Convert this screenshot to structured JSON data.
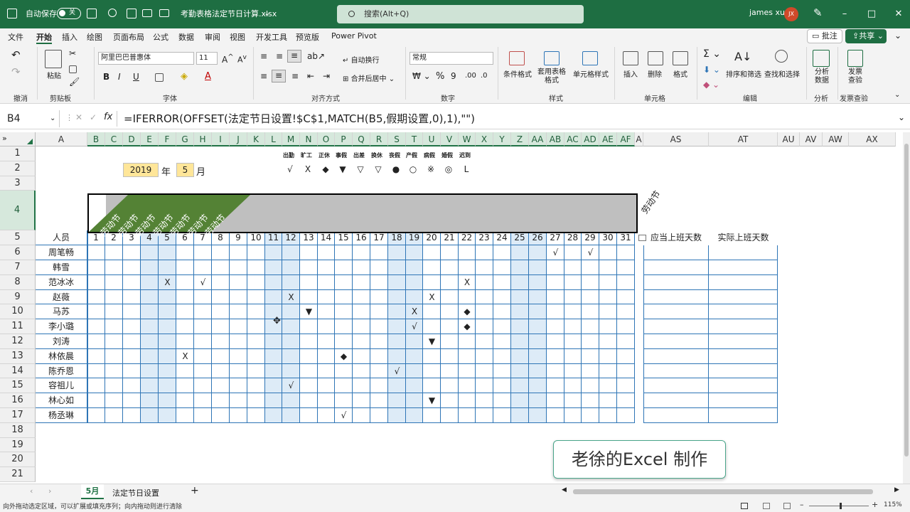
{
  "titlebar": {
    "autosave": "自动保存",
    "autosave_state": "关",
    "filename": "考勤表格法定节日计算.xlsx",
    "search_placeholder": "搜索(Alt+Q)",
    "user": "james xu",
    "initials": "JX"
  },
  "menu": {
    "items": [
      "文件",
      "开始",
      "插入",
      "绘图",
      "页面布局",
      "公式",
      "数据",
      "审阅",
      "视图",
      "开发工具",
      "预览版",
      "Power Pivot"
    ],
    "active": "开始",
    "comment": "批注",
    "share": "共享"
  },
  "ribbon": {
    "undo_group": "撤消",
    "clipboard": {
      "label": "剪贴板",
      "paste": "粘贴"
    },
    "font": {
      "label": "字体",
      "name": "阿里巴巴普惠体",
      "size": "11",
      "bold": "B",
      "italic": "I",
      "underline": "U"
    },
    "align": {
      "label": "对齐方式",
      "wrap": "自动换行",
      "merge": "合并后居中"
    },
    "number": {
      "label": "数字",
      "format": "常规"
    },
    "styles": {
      "label": "样式",
      "cond": "条件格式",
      "table": "套用表格格式",
      "cell": "单元格样式"
    },
    "cells": {
      "label": "单元格",
      "insert": "插入",
      "delete": "删除",
      "format": "格式"
    },
    "edit": {
      "label": "编辑",
      "sort": "排序和筛选",
      "find": "查找和选择"
    },
    "analysis": {
      "label": "分析",
      "btn": "分析数据"
    },
    "invoice": {
      "label": "发票查验",
      "btn": "发票查验"
    }
  },
  "formula_bar": {
    "cell": "B4",
    "formula": "=IFERROR(OFFSET(法定节日设置!$C$1,MATCH(B5,假期设置,0),1),\"\")",
    "fx": "fx"
  },
  "columns": [
    "A",
    "B",
    "C",
    "D",
    "E",
    "F",
    "G",
    "H",
    "I",
    "J",
    "K",
    "L",
    "M",
    "N",
    "O",
    "P",
    "Q",
    "R",
    "S",
    "T",
    "U",
    "V",
    "W",
    "X",
    "Y",
    "Z",
    "AA",
    "AB",
    "AC",
    "AD",
    "AE",
    "AF",
    "A",
    "AS",
    "AT",
    "AU",
    "AV",
    "AW",
    "AX"
  ],
  "rows": [
    "1",
    "2",
    "3",
    "4",
    "5",
    "6",
    "7",
    "8",
    "9",
    "10",
    "11",
    "12",
    "13",
    "14",
    "15",
    "16",
    "17",
    "18",
    "19",
    "20",
    "21"
  ],
  "sheet": {
    "year": "2019",
    "year_label": "年",
    "month": "5",
    "month_label": "月",
    "legend_labels": [
      "出勤",
      "旷工",
      "正休",
      "事假",
      "出差",
      "换休",
      "丧假",
      "产假",
      "病假",
      "婚假",
      "迟到"
    ],
    "legend_symbols": [
      "√",
      "X",
      "◆",
      "▼",
      "▽",
      "▽",
      "●",
      "○",
      "※",
      "◎",
      "L"
    ],
    "holiday": "劳动节",
    "header_person": "人员",
    "days": [
      "1",
      "2",
      "3",
      "4",
      "5",
      "6",
      "7",
      "8",
      "9",
      "10",
      "11",
      "12",
      "13",
      "14",
      "15",
      "16",
      "17",
      "18",
      "19",
      "20",
      "21",
      "22",
      "23",
      "24",
      "25",
      "26",
      "27",
      "28",
      "29",
      "30",
      "31"
    ],
    "col_should": "应当上班天数",
    "col_actual": "实际上班天数",
    "people": [
      "周笔畅",
      "韩雪",
      "范冰冰",
      "赵薇",
      "马苏",
      "李小璐",
      "刘涛",
      "林依晨",
      "陈乔恩",
      "容祖儿",
      "林心如",
      "杨丞琳"
    ],
    "marks": [
      {
        "row": 0,
        "day": 27,
        "v": "√"
      },
      {
        "row": 0,
        "day": 29,
        "v": "√"
      },
      {
        "row": 2,
        "day": 5,
        "v": "X"
      },
      {
        "row": 2,
        "day": 7,
        "v": "√"
      },
      {
        "row": 2,
        "day": 22,
        "v": "X"
      },
      {
        "row": 3,
        "day": 12,
        "v": "X"
      },
      {
        "row": 3,
        "day": 20,
        "v": "X"
      },
      {
        "row": 4,
        "day": 13,
        "v": "▼"
      },
      {
        "row": 4,
        "day": 19,
        "v": "X"
      },
      {
        "row": 4,
        "day": 22,
        "v": "◆"
      },
      {
        "row": 5,
        "day": 19,
        "v": "√"
      },
      {
        "row": 5,
        "day": 22,
        "v": "◆"
      },
      {
        "row": 6,
        "day": 20,
        "v": "▼"
      },
      {
        "row": 7,
        "day": 6,
        "v": "X"
      },
      {
        "row": 7,
        "day": 15,
        "v": "◆"
      },
      {
        "row": 8,
        "day": 18,
        "v": "√"
      },
      {
        "row": 9,
        "day": 12,
        "v": "√"
      },
      {
        "row": 10,
        "day": 20,
        "v": "▼"
      },
      {
        "row": 11,
        "day": 15,
        "v": "√"
      }
    ],
    "weekend_days": [
      4,
      5,
      11,
      12,
      18,
      19,
      25,
      26
    ]
  },
  "tabs": {
    "sheets": [
      "5月",
      "法定节日设置"
    ],
    "active": "5月",
    "add": "+"
  },
  "status": {
    "text": "向外拖动选定区域，可以扩展或填充序列；向内拖动则进行清除",
    "zoom": "115%"
  },
  "overlay": {
    "caption": "老徐的Excel 制作"
  },
  "colors": {
    "accent": "#1e6e42",
    "holiday_green": "#548235",
    "grid_blue": "#2e75b6",
    "weekend": "#ddebf7",
    "input_yellow": "#ffe699"
  }
}
